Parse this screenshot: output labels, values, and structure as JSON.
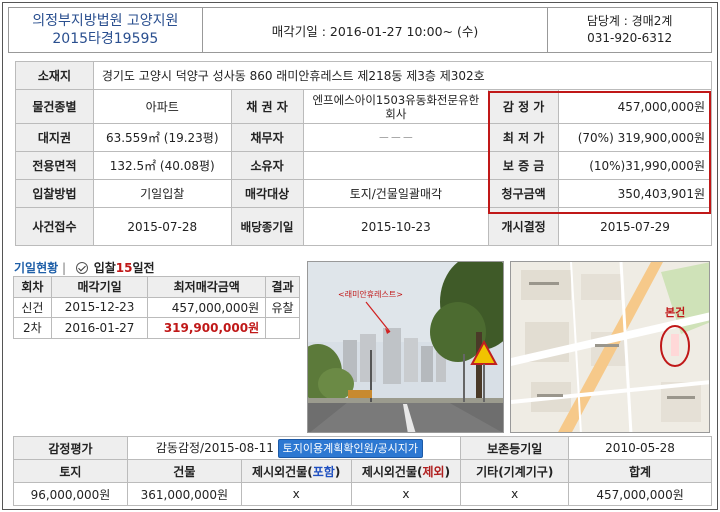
{
  "header": {
    "court": "의정부지방법원 고양지원",
    "case_no": "2015타경19595",
    "sale_date": "매각기일 : 2016-01-27   10:00~ (수)",
    "staff": "담당계 : 경매2계",
    "phone": "031-920-6312"
  },
  "info": {
    "address_label": "소재지",
    "address": "경기도 고양시 덕양구 성사동 860 래미안휴레스트 제218동 제3층 제302호",
    "type_label": "물건종별",
    "type": "아파트",
    "creditor_label": "채 권 자",
    "creditor": "엔프에스아이1503유동화전문유한회사",
    "appraisal_label": "감 정 가",
    "appraisal": "457,000,000원",
    "land_right_label": "대지권",
    "land_right": "63.559㎡ (19.23평)",
    "debtor_label": "채무자",
    "debtor": "－－－",
    "min_price_label": "최 저 가",
    "min_price_pct": "(70%)",
    "min_price": "319,900,000원",
    "area_label": "전용면적",
    "area": "132.5㎡ (40.08평)",
    "owner_label": "소유자",
    "owner": "",
    "deposit_label": "보 증 금",
    "deposit": "(10%)31,990,000원",
    "bid_method_label": "입찰방법",
    "bid_method": "기일입찰",
    "sale_target_label": "매각대상",
    "sale_target": "토지/건물일괄매각",
    "claim_label": "청구금액",
    "claim": "350,403,901원",
    "filed_label": "사건접수",
    "filed": "2015-07-28",
    "dividend_label": "배당종기일",
    "dividend": "2015-10-23",
    "start_label": "개시결정",
    "start": "2015-07-29"
  },
  "history": {
    "title": "기일현황",
    "sep": "|",
    "countdown_prefix": "입찰",
    "countdown_num": "15",
    "countdown_suffix": "일전",
    "headers": [
      "회차",
      "매각기일",
      "최저매각금액",
      "결과"
    ],
    "rows": [
      {
        "round": "신건",
        "date": "2015-12-23",
        "price": "457,000,000원",
        "result": "유찰"
      },
      {
        "round": "2차",
        "date": "2016-01-27",
        "price": "319,900,000원",
        "result": ""
      }
    ]
  },
  "photo": {
    "label": "<래미안휴레스트>"
  },
  "map": {
    "badge": "본건"
  },
  "bottom": {
    "appraisal_label": "감정평가",
    "appraisal_info": "감동감정/2015-08-11",
    "plan_button": "토지이용계획확인원/공시지가",
    "preserve_label": "보존등기일",
    "preserve_date": "2010-05-28",
    "headers": {
      "land": "토지",
      "building": "건물",
      "extra_in_prefix": "제시외건물(",
      "extra_in_word": "포함",
      "extra_out_prefix": "제시외건물(",
      "extra_out_word": "제외",
      "close": ")",
      "etc": "기타(기계기구)",
      "total": "합계"
    },
    "values": {
      "land": "96,000,000원",
      "building": "361,000,000원",
      "extra_in": "x",
      "extra_out": "x",
      "etc": "x",
      "total": "457,000,000원"
    }
  },
  "colors": {
    "accent_red": "#c01818",
    "link_blue": "#1f5fa8",
    "button_blue": "#2d78d2"
  }
}
